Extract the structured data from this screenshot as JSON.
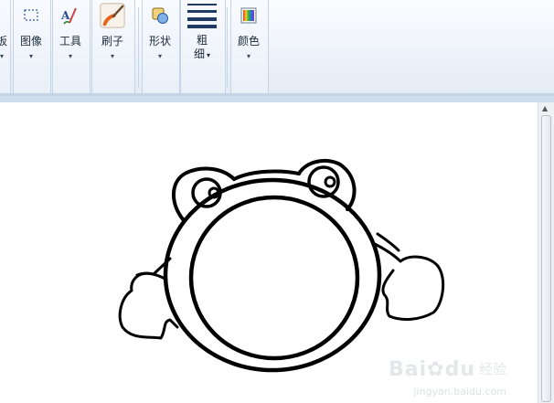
{
  "ribbon": {
    "groups": [
      {
        "label": "板",
        "icon": "clipboard-icon"
      },
      {
        "label": "图像",
        "icon": "select-icon"
      },
      {
        "label": "工具",
        "icon": "tools-icon"
      },
      {
        "label": "刷子",
        "icon": "brush-icon"
      },
      {
        "label": "形状",
        "icon": "shapes-icon"
      },
      {
        "label": "粗细",
        "line1": "粗",
        "line2": "细",
        "icon": "line-width-icon"
      },
      {
        "label": "颜色",
        "icon": "color-icon"
      }
    ],
    "dropdown_glyph": "▾"
  },
  "canvas": {
    "drawing": "frog-doodle",
    "stroke_color": "#000000"
  },
  "watermark": {
    "brand": "Bai",
    "brand2": "du",
    "cn": "经验",
    "url": "jingyan.baidu.com"
  },
  "colors": {
    "ribbon_bg": "#eef3fa",
    "canvas_bg": "#ffffff",
    "brush_orange": "#e8621c"
  }
}
